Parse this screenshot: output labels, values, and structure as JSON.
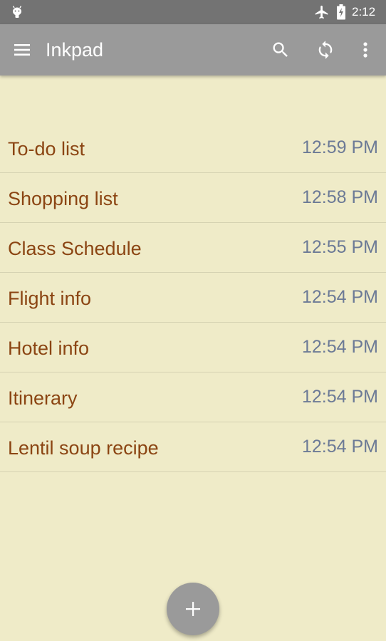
{
  "status_bar": {
    "time": "2:12",
    "icons": [
      "android-debug-icon",
      "airplane-mode-icon",
      "battery-charging-icon"
    ]
  },
  "app_bar": {
    "title": "Inkpad",
    "icons": [
      "menu-icon",
      "search-icon",
      "sync-icon",
      "more-vert-icon"
    ]
  },
  "notes": [
    {
      "title": "To-do list",
      "time": "12:59 PM"
    },
    {
      "title": "Shopping list",
      "time": "12:58 PM"
    },
    {
      "title": "Class Schedule",
      "time": "12:55 PM"
    },
    {
      "title": "Flight info",
      "time": "12:54 PM"
    },
    {
      "title": "Hotel info",
      "time": "12:54 PM"
    },
    {
      "title": "Itinerary",
      "time": "12:54 PM"
    },
    {
      "title": "Lentil soup recipe",
      "time": "12:54 PM"
    }
  ],
  "fab": {
    "icon": "plus-icon"
  },
  "colors": {
    "background": "#efebc8",
    "status_bar": "#737373",
    "app_bar": "#9a9a9a",
    "note_title": "#8b4513",
    "note_time": "#6c7a96",
    "divider": "#d5d2b2",
    "fab": "#9a9a9a"
  }
}
